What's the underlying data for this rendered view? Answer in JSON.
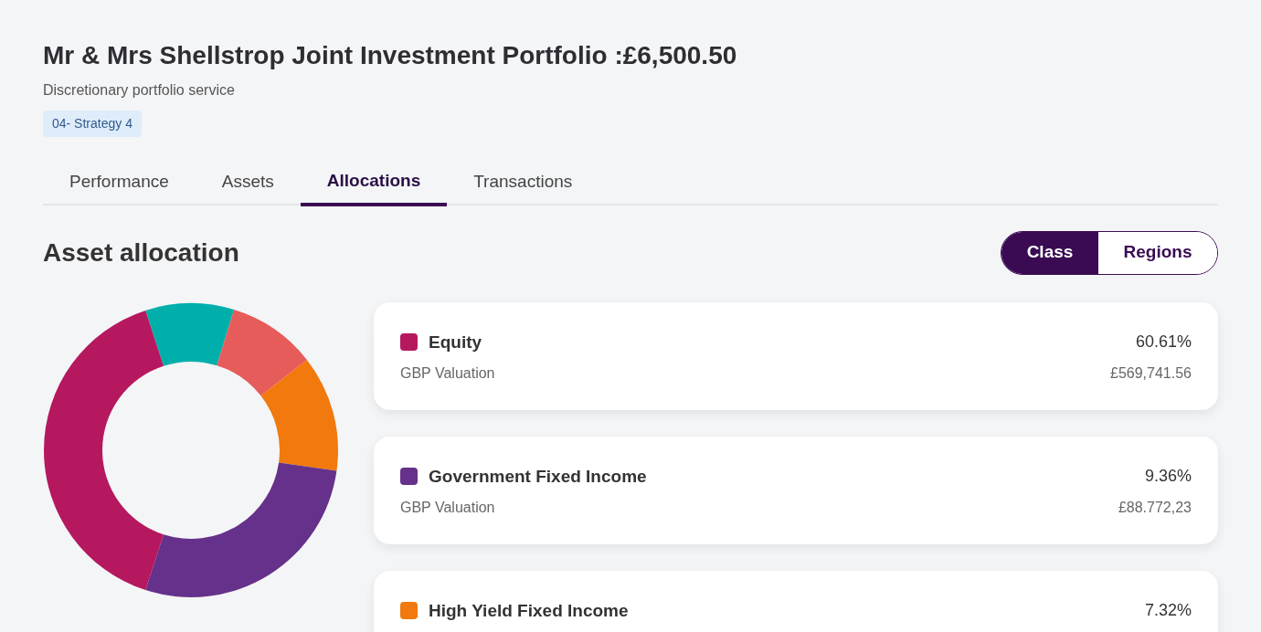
{
  "header": {
    "title": "Mr & Mrs Shellstrop Joint Investment Portfolio :£6,500.50",
    "subtitle": "Discretionary portfolio service",
    "badge": "04- Strategy 4"
  },
  "tabs": [
    {
      "label": "Performance",
      "selected": false
    },
    {
      "label": "Assets",
      "selected": false
    },
    {
      "label": "Allocations",
      "selected": true
    },
    {
      "label": "Transactions",
      "selected": false
    }
  ],
  "section": {
    "title": "Asset allocation"
  },
  "toggle": [
    {
      "label": "Class",
      "selected": true
    },
    {
      "label": "Regions",
      "selected": false
    }
  ],
  "allocations": [
    {
      "name": "Equity",
      "color": "#b5185f",
      "percent": "60.61%",
      "valuation_label": "GBP Valuation",
      "valuation": "£569,741.56"
    },
    {
      "name": "Government Fixed Income",
      "color": "#66318a",
      "percent": "9.36%",
      "valuation_label": "GBP Valuation",
      "valuation": "£88.772,23"
    },
    {
      "name": "High Yield Fixed Income",
      "color": "#f1790d",
      "percent": "7.32%"
    }
  ]
}
